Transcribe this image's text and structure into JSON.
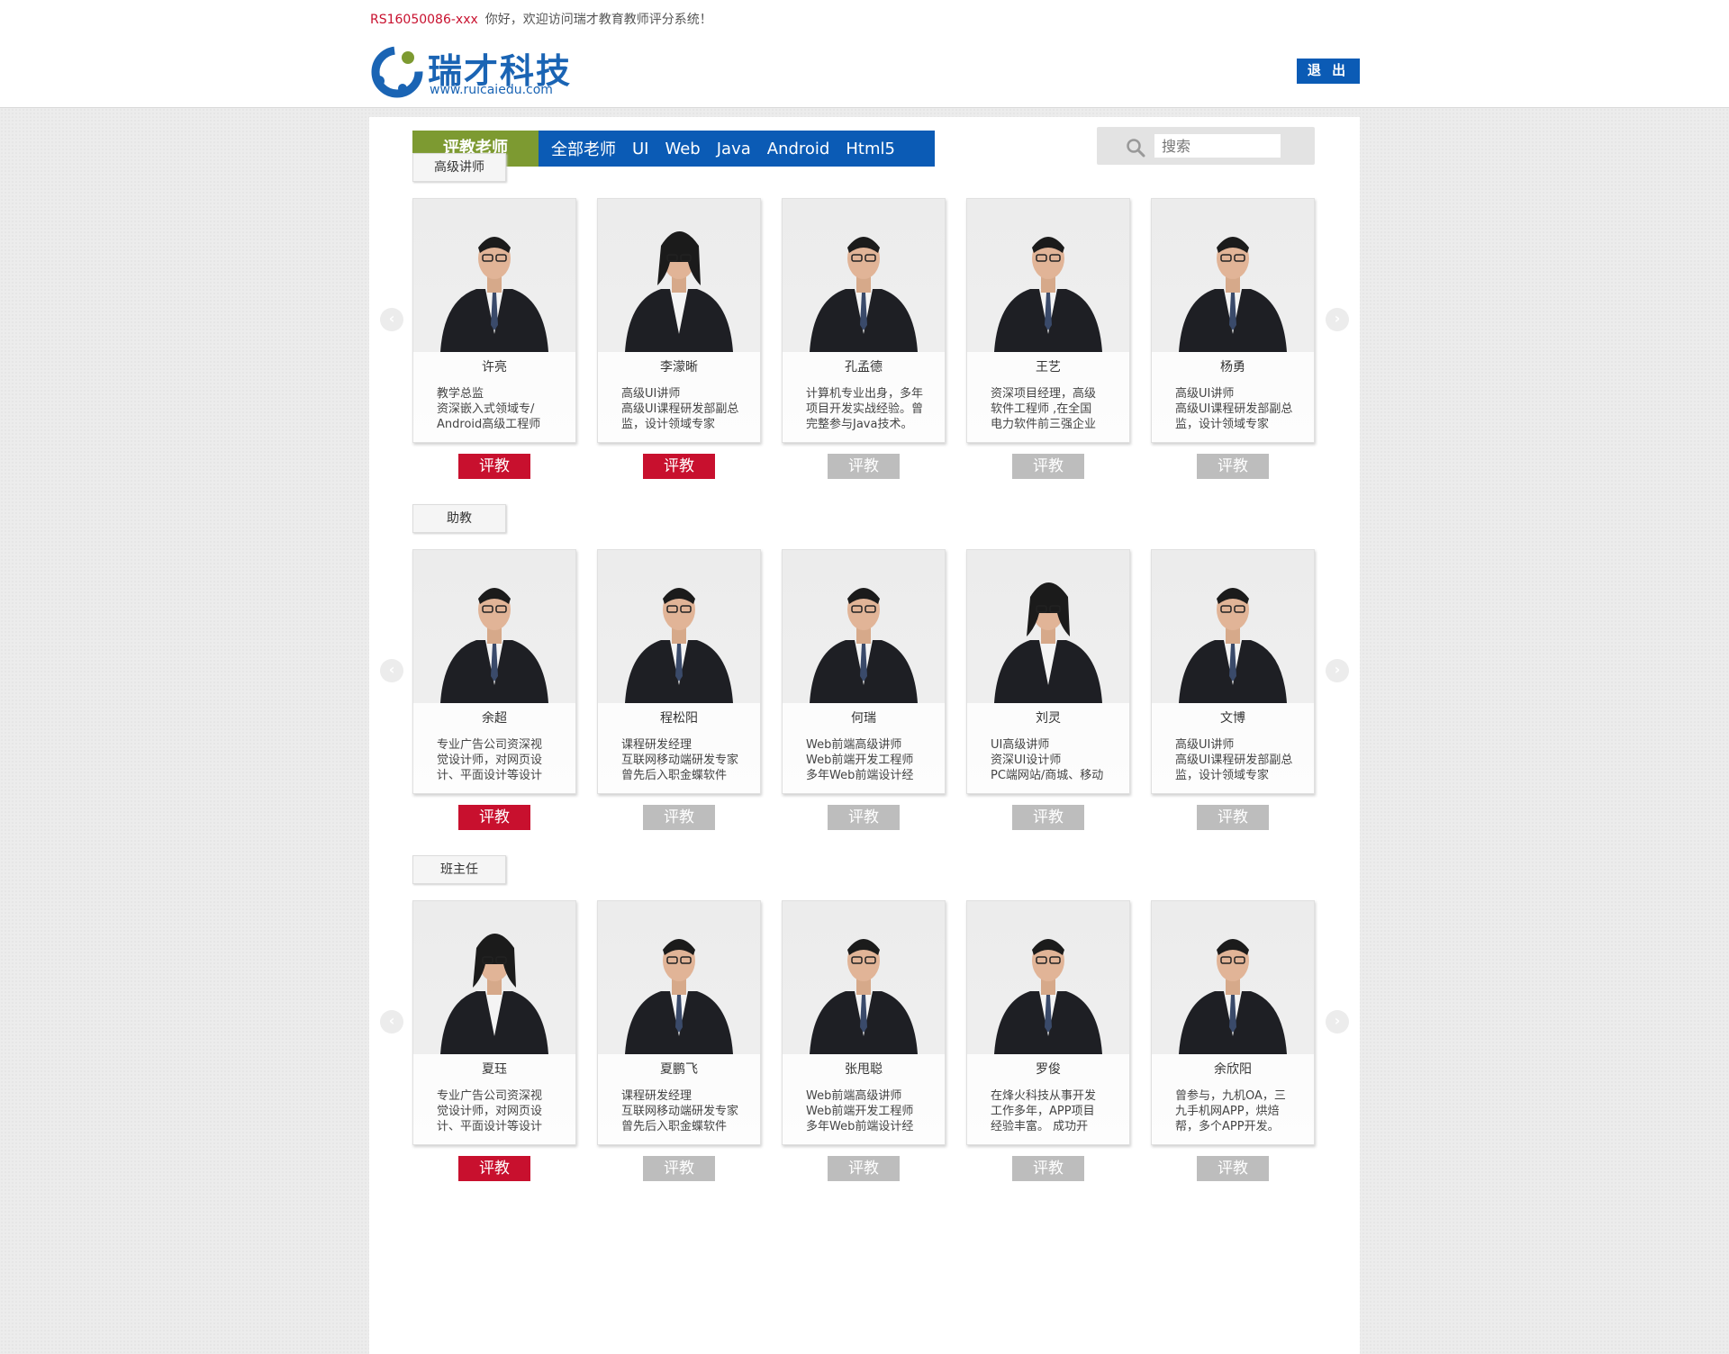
{
  "header": {
    "user_id": "RS16050086-xxx",
    "welcome_text": "你好，欢迎访问瑞才教育教师评分系统！",
    "logo_name": "瑞才科技",
    "logo_url": "www.ruicaiedu.com",
    "logout_label": "退 出"
  },
  "nav": {
    "primary_tab": "评教老师",
    "categories": [
      "全部老师",
      "UI",
      "Web",
      "Java",
      "Android",
      "Html5"
    ]
  },
  "search": {
    "placeholder": "搜索"
  },
  "colors": {
    "brand_blue": "#0b5bb5",
    "nav_green": "#7d9a31",
    "active_red": "#c8102e",
    "inactive_grey": "#bdbdbd"
  },
  "sections": [
    {
      "label": "高级讲师",
      "teachers": [
        {
          "name": "许亮",
          "desc": "教学总监\n资深嵌入式领域专/\nAndroid高级工程师",
          "button": "评教",
          "active": true
        },
        {
          "name": "李濛晰",
          "desc": "高级UI讲师\n高级UI课程研发部副总\n监，设计领域专家",
          "button": "评教",
          "active": true
        },
        {
          "name": "孔孟德",
          "desc": "计算机专业出身，多年\n项目开发实战经验。曾\n完整参与Java技术。",
          "button": "评教",
          "active": false
        },
        {
          "name": "王艺",
          "desc": "资深项目经理，高级\n软件工程师 ,在全国\n电力软件前三强企业",
          "button": "评教",
          "active": false
        },
        {
          "name": "杨勇",
          "desc": "高级UI讲师\n高级UI课程研发部副总\n监，设计领域专家",
          "button": "评教",
          "active": false
        }
      ]
    },
    {
      "label": "助教",
      "teachers": [
        {
          "name": "余超",
          "desc": "专业广告公司资深视\n觉设计师，对网页设\n计、平面设计等设计",
          "button": "评教",
          "active": true
        },
        {
          "name": "程松阳",
          "desc": "课程研发经理\n互联网移动端研发专家\n曾先后入职金蝶软件",
          "button": "评教",
          "active": false
        },
        {
          "name": "何瑞",
          "desc": "Web前端高级讲师\nWeb前端开发工程师\n多年Web前端设计经",
          "button": "评教",
          "active": false
        },
        {
          "name": "刘灵",
          "desc": "UI高级讲师\n资深UI设计师\nPC端网站/商城、移动",
          "button": "评教",
          "active": false
        },
        {
          "name": "文博",
          "desc": "高级UI讲师\n高级UI课程研发部副总\n监，设计领域专家",
          "button": "评教",
          "active": false
        }
      ]
    },
    {
      "label": "班主任",
      "teachers": [
        {
          "name": "夏珏",
          "desc": "专业广告公司资深视\n觉设计师，对网页设\n计、平面设计等设计",
          "button": "评教",
          "active": true
        },
        {
          "name": "夏鹏飞",
          "desc": "课程研发经理\n互联网移动端研发专家\n曾先后入职金蝶软件",
          "button": "评教",
          "active": false
        },
        {
          "name": "张甩聪",
          "desc": "Web前端高级讲师\nWeb前端开发工程师\n多年Web前端设计经",
          "button": "评教",
          "active": false
        },
        {
          "name": "罗俊",
          "desc": "在烽火科技从事开发\n工作多年，APP项目\n经验丰富。 成功开",
          "button": "评教",
          "active": false
        },
        {
          "name": "余欣阳",
          "desc": "曾参与，九机OA，三\n九手机网APP，烘焙\n帮，多个APP开发。",
          "button": "评教",
          "active": false
        }
      ]
    }
  ]
}
